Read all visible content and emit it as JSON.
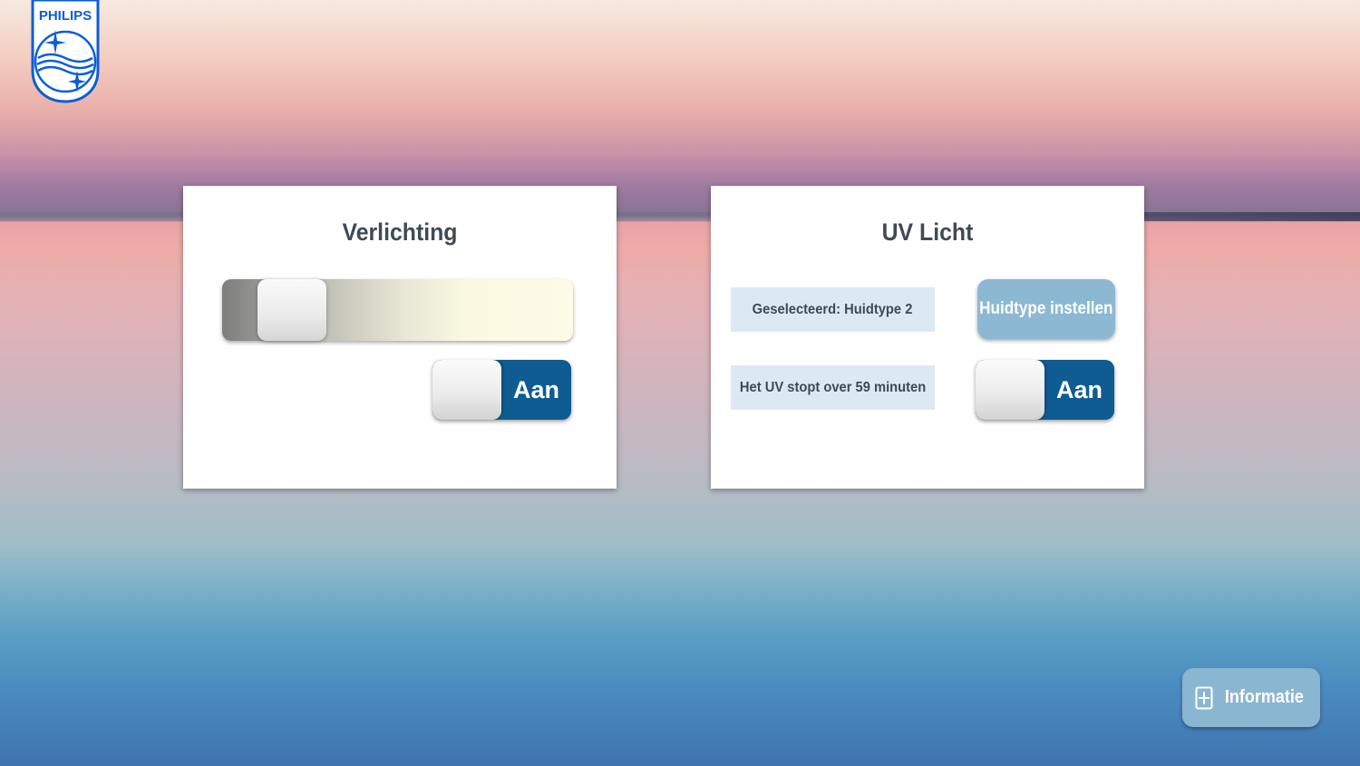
{
  "brand": {
    "name": "PHILIPS",
    "logo_color": "#0b5ed7"
  },
  "lighting": {
    "title": "Verlichting",
    "brightness_level": 0.0,
    "toggle_label": "Aan",
    "toggle_on": true
  },
  "uv": {
    "title": "UV Licht",
    "selected_text": "Geselecteerd: Huidtype 2",
    "timer_text": "Het UV stopt over 59 minuten",
    "skin_button_label": "Huidtype instellen",
    "toggle_label": "Aan",
    "toggle_on": true
  },
  "footer": {
    "info_button_label": "Informatie",
    "info_icon": "plus-icon"
  },
  "colors": {
    "toggle_on": "#0e5c91",
    "button": "#8db8d3",
    "info_box": "#dce9f2",
    "title_text": "#3f4a54"
  }
}
